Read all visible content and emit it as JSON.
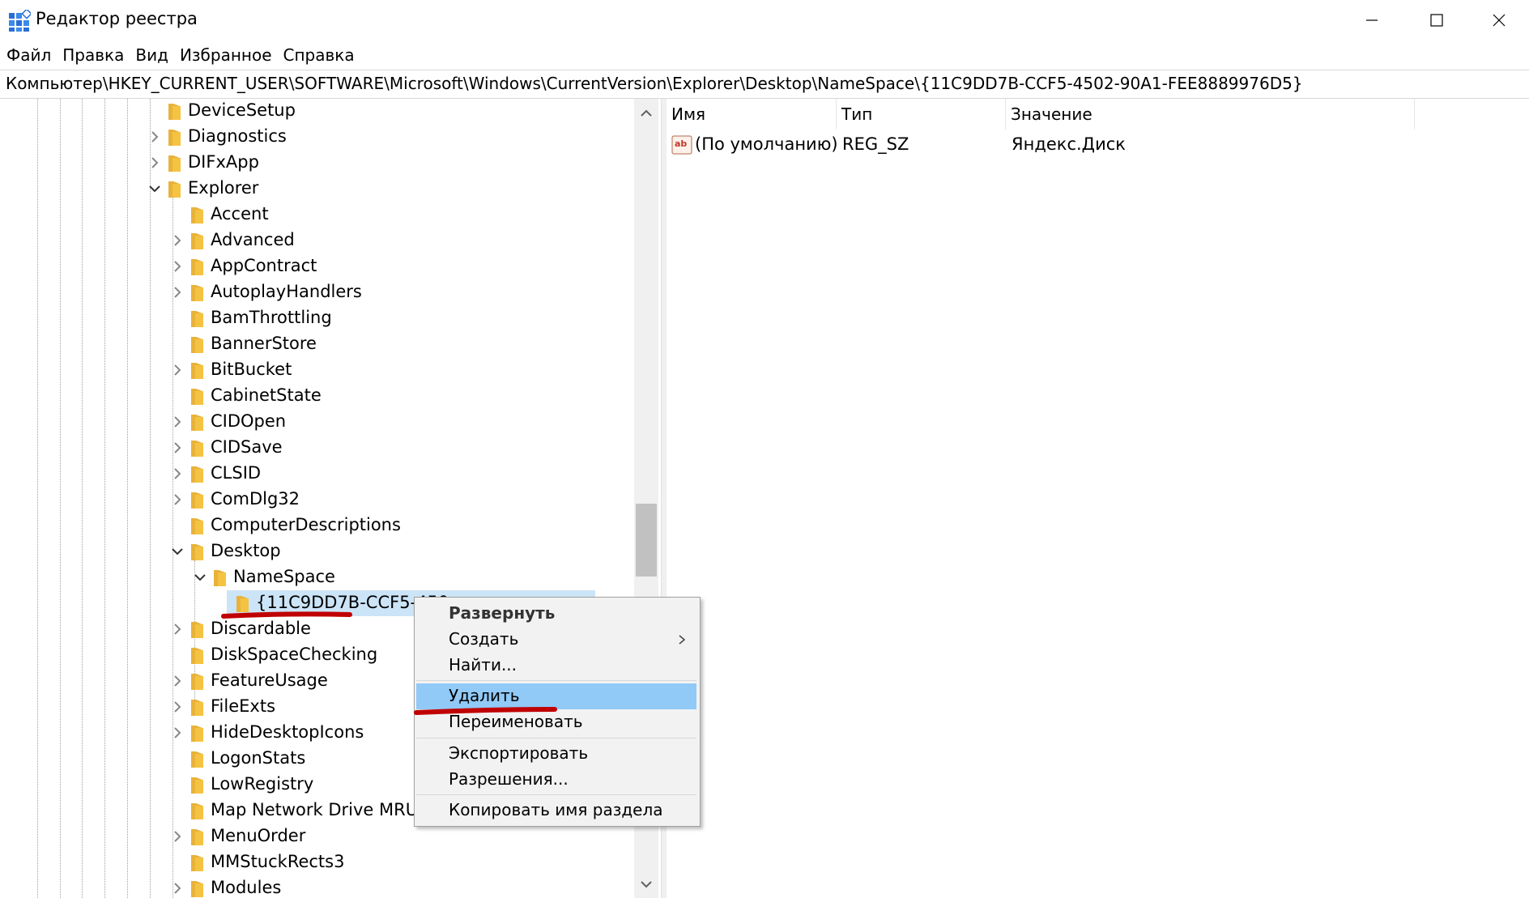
{
  "window": {
    "title": "Редактор реестра",
    "icon": "regedit-icon"
  },
  "menubar": {
    "items": [
      "Файл",
      "Правка",
      "Вид",
      "Избранное",
      "Справка"
    ]
  },
  "address": {
    "path": "Компьютер\\HKEY_CURRENT_USER\\SOFTWARE\\Microsoft\\Windows\\CurrentVersion\\Explorer\\Desktop\\NameSpace\\{11C9DD7B-CCF5-4502-90A1-FEE8889976D5}"
  },
  "tree": {
    "nodes": [
      {
        "label": "DeviceSetup"
      },
      {
        "label": "Diagnostics"
      },
      {
        "label": "DIFxApp"
      },
      {
        "label": "Explorer"
      },
      {
        "label": "Accent"
      },
      {
        "label": "Advanced"
      },
      {
        "label": "AppContract"
      },
      {
        "label": "AutoplayHandlers"
      },
      {
        "label": "BamThrottling"
      },
      {
        "label": "BannerStore"
      },
      {
        "label": "BitBucket"
      },
      {
        "label": "CabinetState"
      },
      {
        "label": "CIDOpen"
      },
      {
        "label": "CIDSave"
      },
      {
        "label": "CLSID"
      },
      {
        "label": "ComDlg32"
      },
      {
        "label": "ComputerDescriptions"
      },
      {
        "label": "Desktop"
      },
      {
        "label": "NameSpace"
      },
      {
        "label": "{11C9DD7B-CCF5-450"
      },
      {
        "label": "Discardable"
      },
      {
        "label": "DiskSpaceChecking"
      },
      {
        "label": "FeatureUsage"
      },
      {
        "label": "FileExts"
      },
      {
        "label": "HideDesktopIcons"
      },
      {
        "label": "LogonStats"
      },
      {
        "label": "LowRegistry"
      },
      {
        "label": "Map Network Drive MRU"
      },
      {
        "label": "MenuOrder"
      },
      {
        "label": "MMStuckRects3"
      },
      {
        "label": "Modules"
      }
    ]
  },
  "list": {
    "columns": [
      "Имя",
      "Тип",
      "Значение"
    ],
    "rows": [
      {
        "name": "(По умолчанию)",
        "type": "REG_SZ",
        "value": "Яндекс.Диск",
        "icon": "reg-sz-icon"
      }
    ]
  },
  "context_menu": {
    "items": [
      "Развернуть",
      "Создать",
      "Найти...",
      "Удалить",
      "Переименовать",
      "Экспортировать",
      "Разрешения...",
      "Копировать имя раздела"
    ],
    "highlighted": "Удалить"
  },
  "colors": {
    "selection": "#cce4f7",
    "menu_highlight": "#91c9f7",
    "annotation": "#c00000",
    "folder": "#f5c342"
  }
}
